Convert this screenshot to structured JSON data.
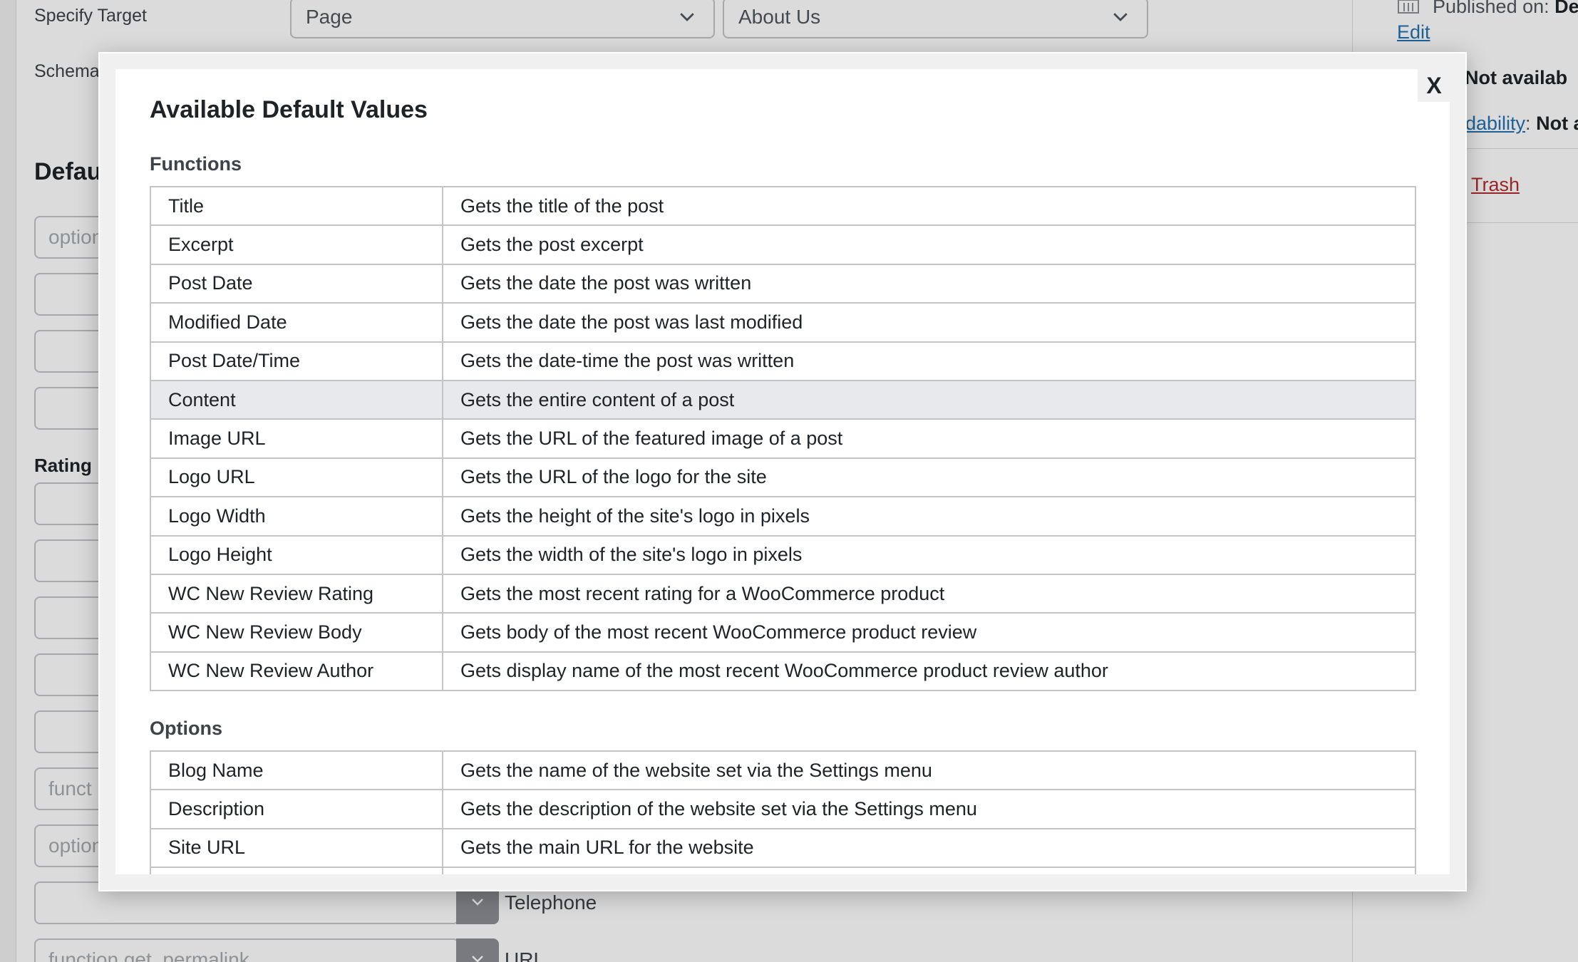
{
  "background": {
    "specify_target_label": "Specify Target",
    "target_type": "Page",
    "target_value": "About Us",
    "schema_label": "Schema",
    "defaults_heading": "Defau",
    "rating_label": "Rating",
    "fields": [
      {
        "value": "option",
        "tag": ""
      },
      {
        "value": "",
        "tag": ""
      },
      {
        "value": "",
        "tag": ""
      },
      {
        "value": "",
        "tag": ""
      },
      {
        "value": "",
        "tag": ""
      },
      {
        "value": "",
        "tag": ""
      },
      {
        "value": "",
        "tag": ""
      },
      {
        "value": "",
        "tag": ""
      },
      {
        "value": "",
        "tag": ""
      },
      {
        "value": "funct",
        "tag": ""
      },
      {
        "value": "option",
        "tag": ""
      },
      {
        "value": "",
        "tag": "Telephone"
      },
      {
        "value": "function get_permalink",
        "tag": "URL"
      }
    ],
    "sidebar": {
      "published_label": "Published on:",
      "published_value": "De",
      "edit_link": "Edit",
      "row2_link": "",
      "row2_value": "Not availab",
      "row3_link": "dability",
      "row3_value": "Not a",
      "trash_link": "Trash"
    }
  },
  "modal": {
    "close_label": "X",
    "title": "Available Default Values",
    "functions_heading": "Functions",
    "functions": [
      {
        "name": "Title",
        "description": "Gets the title of the post"
      },
      {
        "name": "Excerpt",
        "description": "Gets the post excerpt"
      },
      {
        "name": "Post Date",
        "description": "Gets the date the post was written"
      },
      {
        "name": "Modified Date",
        "description": "Gets the date the post was last modified"
      },
      {
        "name": "Post Date/Time",
        "description": "Gets the date-time the post was written"
      },
      {
        "name": "Content",
        "description": "Gets the entire content of a post"
      },
      {
        "name": "Image URL",
        "description": "Gets the URL of the featured image of a post"
      },
      {
        "name": "Logo URL",
        "description": "Gets the URL of the logo for the site"
      },
      {
        "name": "Logo Width",
        "description": "Gets the height of the site's logo in pixels"
      },
      {
        "name": "Logo Height",
        "description": "Gets the width of the site's logo in pixels"
      },
      {
        "name": "WC New Review Rating",
        "description": "Gets the most recent rating for a WooCommerce product"
      },
      {
        "name": "WC New Review Body",
        "description": "Gets body of the most recent WooCommerce product review"
      },
      {
        "name": "WC New Review Author",
        "description": "Gets display name of the most recent WooCommerce product review author"
      }
    ],
    "options_heading": "Options",
    "options": [
      {
        "name": "Blog Name",
        "description": "Gets the name of the website set via the Settings menu"
      },
      {
        "name": "Description",
        "description": "Gets the description of the website set via the Settings menu"
      },
      {
        "name": "Site URL",
        "description": "Gets the main URL for the website"
      },
      {
        "name": "",
        "description": ""
      }
    ],
    "highlighted_row": "Content"
  }
}
